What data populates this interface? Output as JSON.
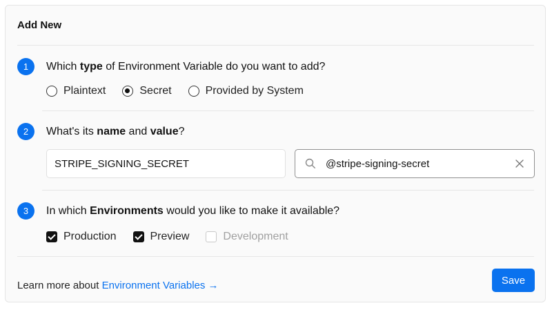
{
  "card": {
    "title": "Add New"
  },
  "steps": [
    {
      "number": "1",
      "question_parts": [
        "Which ",
        "type",
        " of Environment Variable do you want to add?"
      ],
      "options": [
        {
          "label": "Plaintext",
          "checked": false
        },
        {
          "label": "Secret",
          "checked": true
        },
        {
          "label": "Provided by System",
          "checked": false
        }
      ]
    },
    {
      "number": "2",
      "question_parts": [
        "What's its ",
        "name",
        " and ",
        "value",
        "?"
      ],
      "name_input": {
        "value": "STRIPE_SIGNING_SECRET"
      },
      "value_input": {
        "value": "@stripe-signing-secret"
      }
    },
    {
      "number": "3",
      "question_parts": [
        "In which ",
        "Environments",
        " would you like to make it available?"
      ],
      "options": [
        {
          "label": "Production",
          "checked": true,
          "disabled": false
        },
        {
          "label": "Preview",
          "checked": true,
          "disabled": false
        },
        {
          "label": "Development",
          "checked": false,
          "disabled": true
        }
      ]
    }
  ],
  "footer": {
    "text": "Learn more about ",
    "link_label": "Environment Variables →",
    "save_label": "Save"
  },
  "icons": {
    "search": "search-icon",
    "clear": "close-icon"
  },
  "colors": {
    "accent": "#0a72ef",
    "background": "#fafafa",
    "text": "#111111"
  }
}
